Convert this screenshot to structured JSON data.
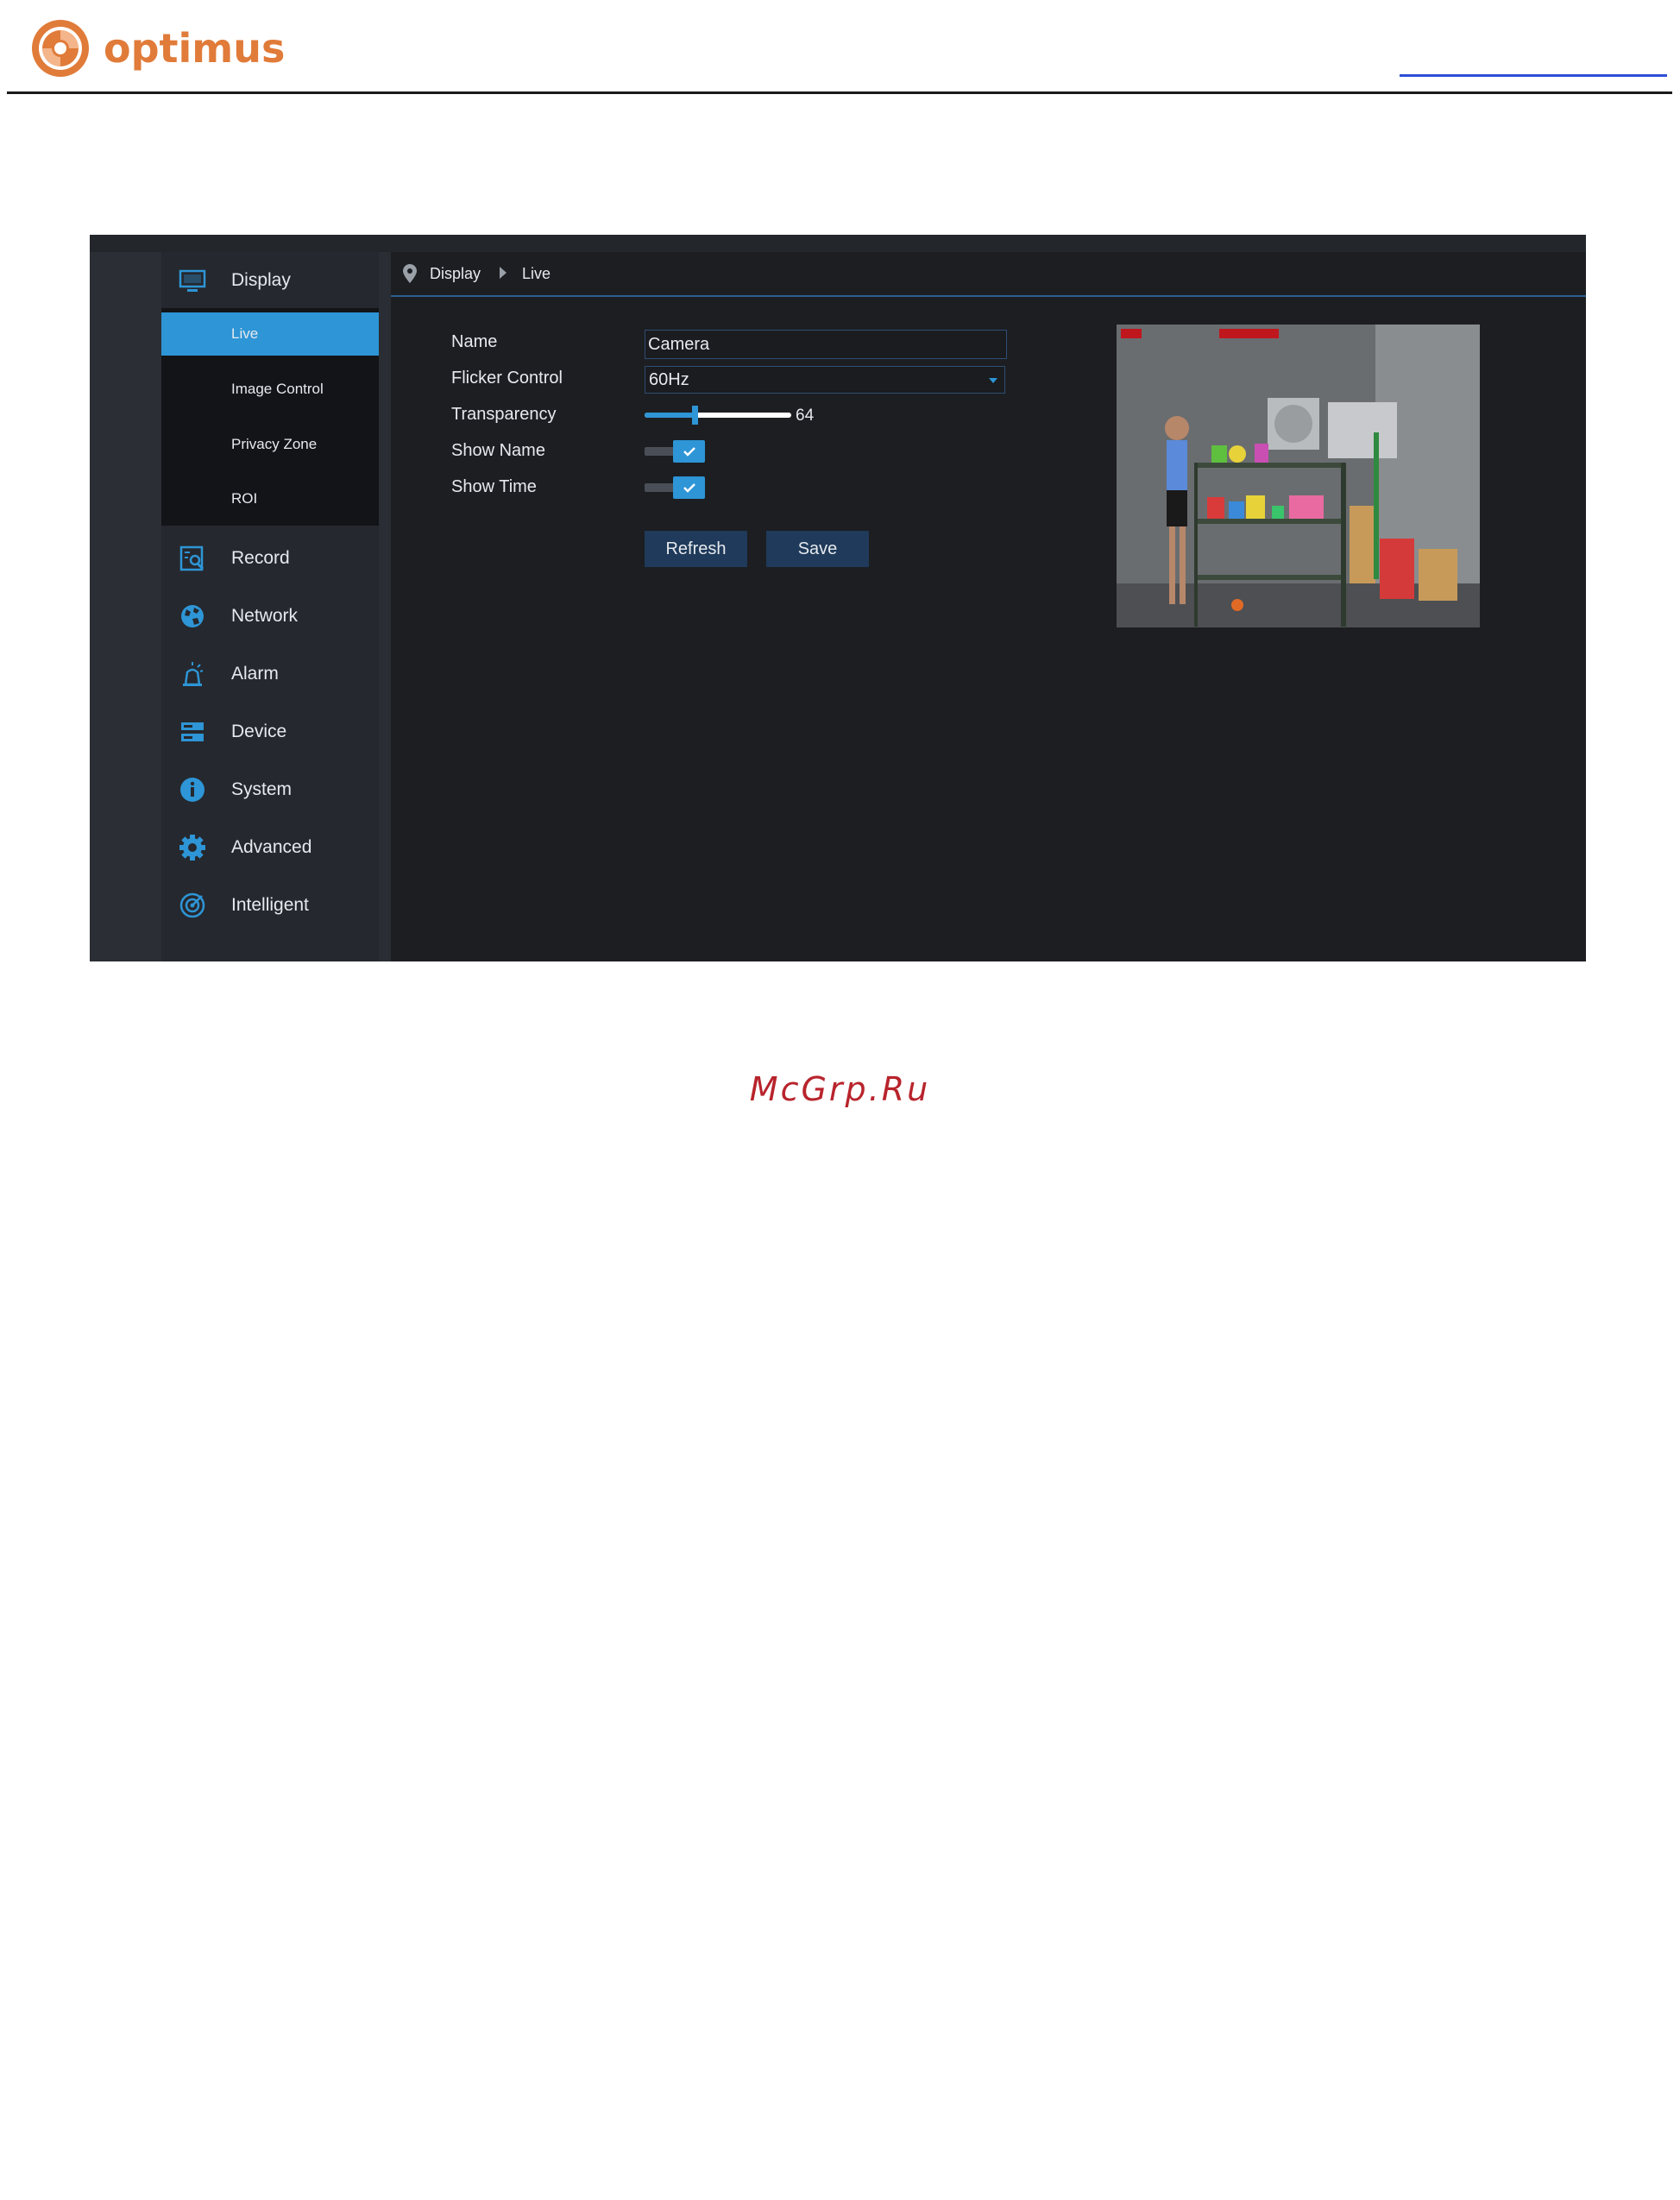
{
  "header": {
    "brand": "optimus",
    "brand_color": "#e07b39"
  },
  "sidebar": {
    "items": [
      {
        "label": "Display",
        "icon": "monitor-icon"
      },
      {
        "label": "Record",
        "icon": "record-search-icon"
      },
      {
        "label": "Network",
        "icon": "globe-icon"
      },
      {
        "label": "Alarm",
        "icon": "alarm-icon"
      },
      {
        "label": "Device",
        "icon": "device-icon"
      },
      {
        "label": "System",
        "icon": "info-icon"
      },
      {
        "label": "Advanced",
        "icon": "gear-icon"
      },
      {
        "label": "Intelligent",
        "icon": "radar-icon"
      }
    ],
    "submenu": [
      "Live",
      "Image Control",
      "Privacy Zone",
      "ROI"
    ],
    "active_sub": "Live",
    "accent": "#2e95d6"
  },
  "breadcrumb": {
    "level1": "Display",
    "level2": "Live"
  },
  "form": {
    "name_label": "Name",
    "name_value": "Camera",
    "flicker_label": "Flicker Control",
    "flicker_value": "60Hz",
    "transparency_label": "Transparency",
    "transparency_value": "64",
    "transparency_fill_percent": 34,
    "show_name_label": "Show Name",
    "show_name_checked": true,
    "show_time_label": "Show Time",
    "show_time_checked": true
  },
  "buttons": {
    "refresh": "Refresh",
    "save": "Save"
  },
  "watermark": "McGrp.Ru"
}
